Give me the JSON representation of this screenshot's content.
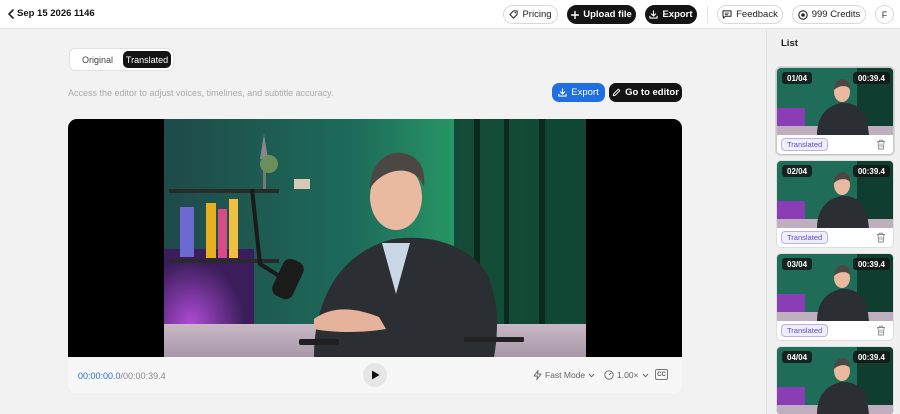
{
  "header": {
    "title": "Sep 15 2026 1146",
    "pricing_label": "Pricing",
    "upload_label": "Upload file",
    "export_label": "Export",
    "feedback_label": "Feedback",
    "credits_label": "999 Credits",
    "avatar_initial": "F"
  },
  "toggle": {
    "original_label": "Original",
    "translated_label": "Translated",
    "active": "Translated"
  },
  "hint": "Access the editor to adjust voices, timelines, and subtitle accuracy.",
  "actions": {
    "export_label": "Export",
    "editor_label": "Go to editor"
  },
  "player": {
    "current_time": "00:00:00.0",
    "total_time": "/00:00:39.4",
    "mode_label": "Fast Mode",
    "speed_label": "1.00×",
    "cc_label": "CC"
  },
  "panel": {
    "title": "List",
    "items": [
      {
        "index": "01/04",
        "duration": "00:39.4",
        "status": "Translated"
      },
      {
        "index": "02/04",
        "duration": "00:39.4",
        "status": "Translated"
      },
      {
        "index": "03/04",
        "duration": "00:39.4",
        "status": "Translated"
      },
      {
        "index": "04/04",
        "duration": "00:39.4",
        "status": ""
      }
    ]
  },
  "colors": {
    "accent_blue": "#1f6fe0",
    "dark_button": "#141414",
    "status_purple": "#5a4cc9"
  }
}
